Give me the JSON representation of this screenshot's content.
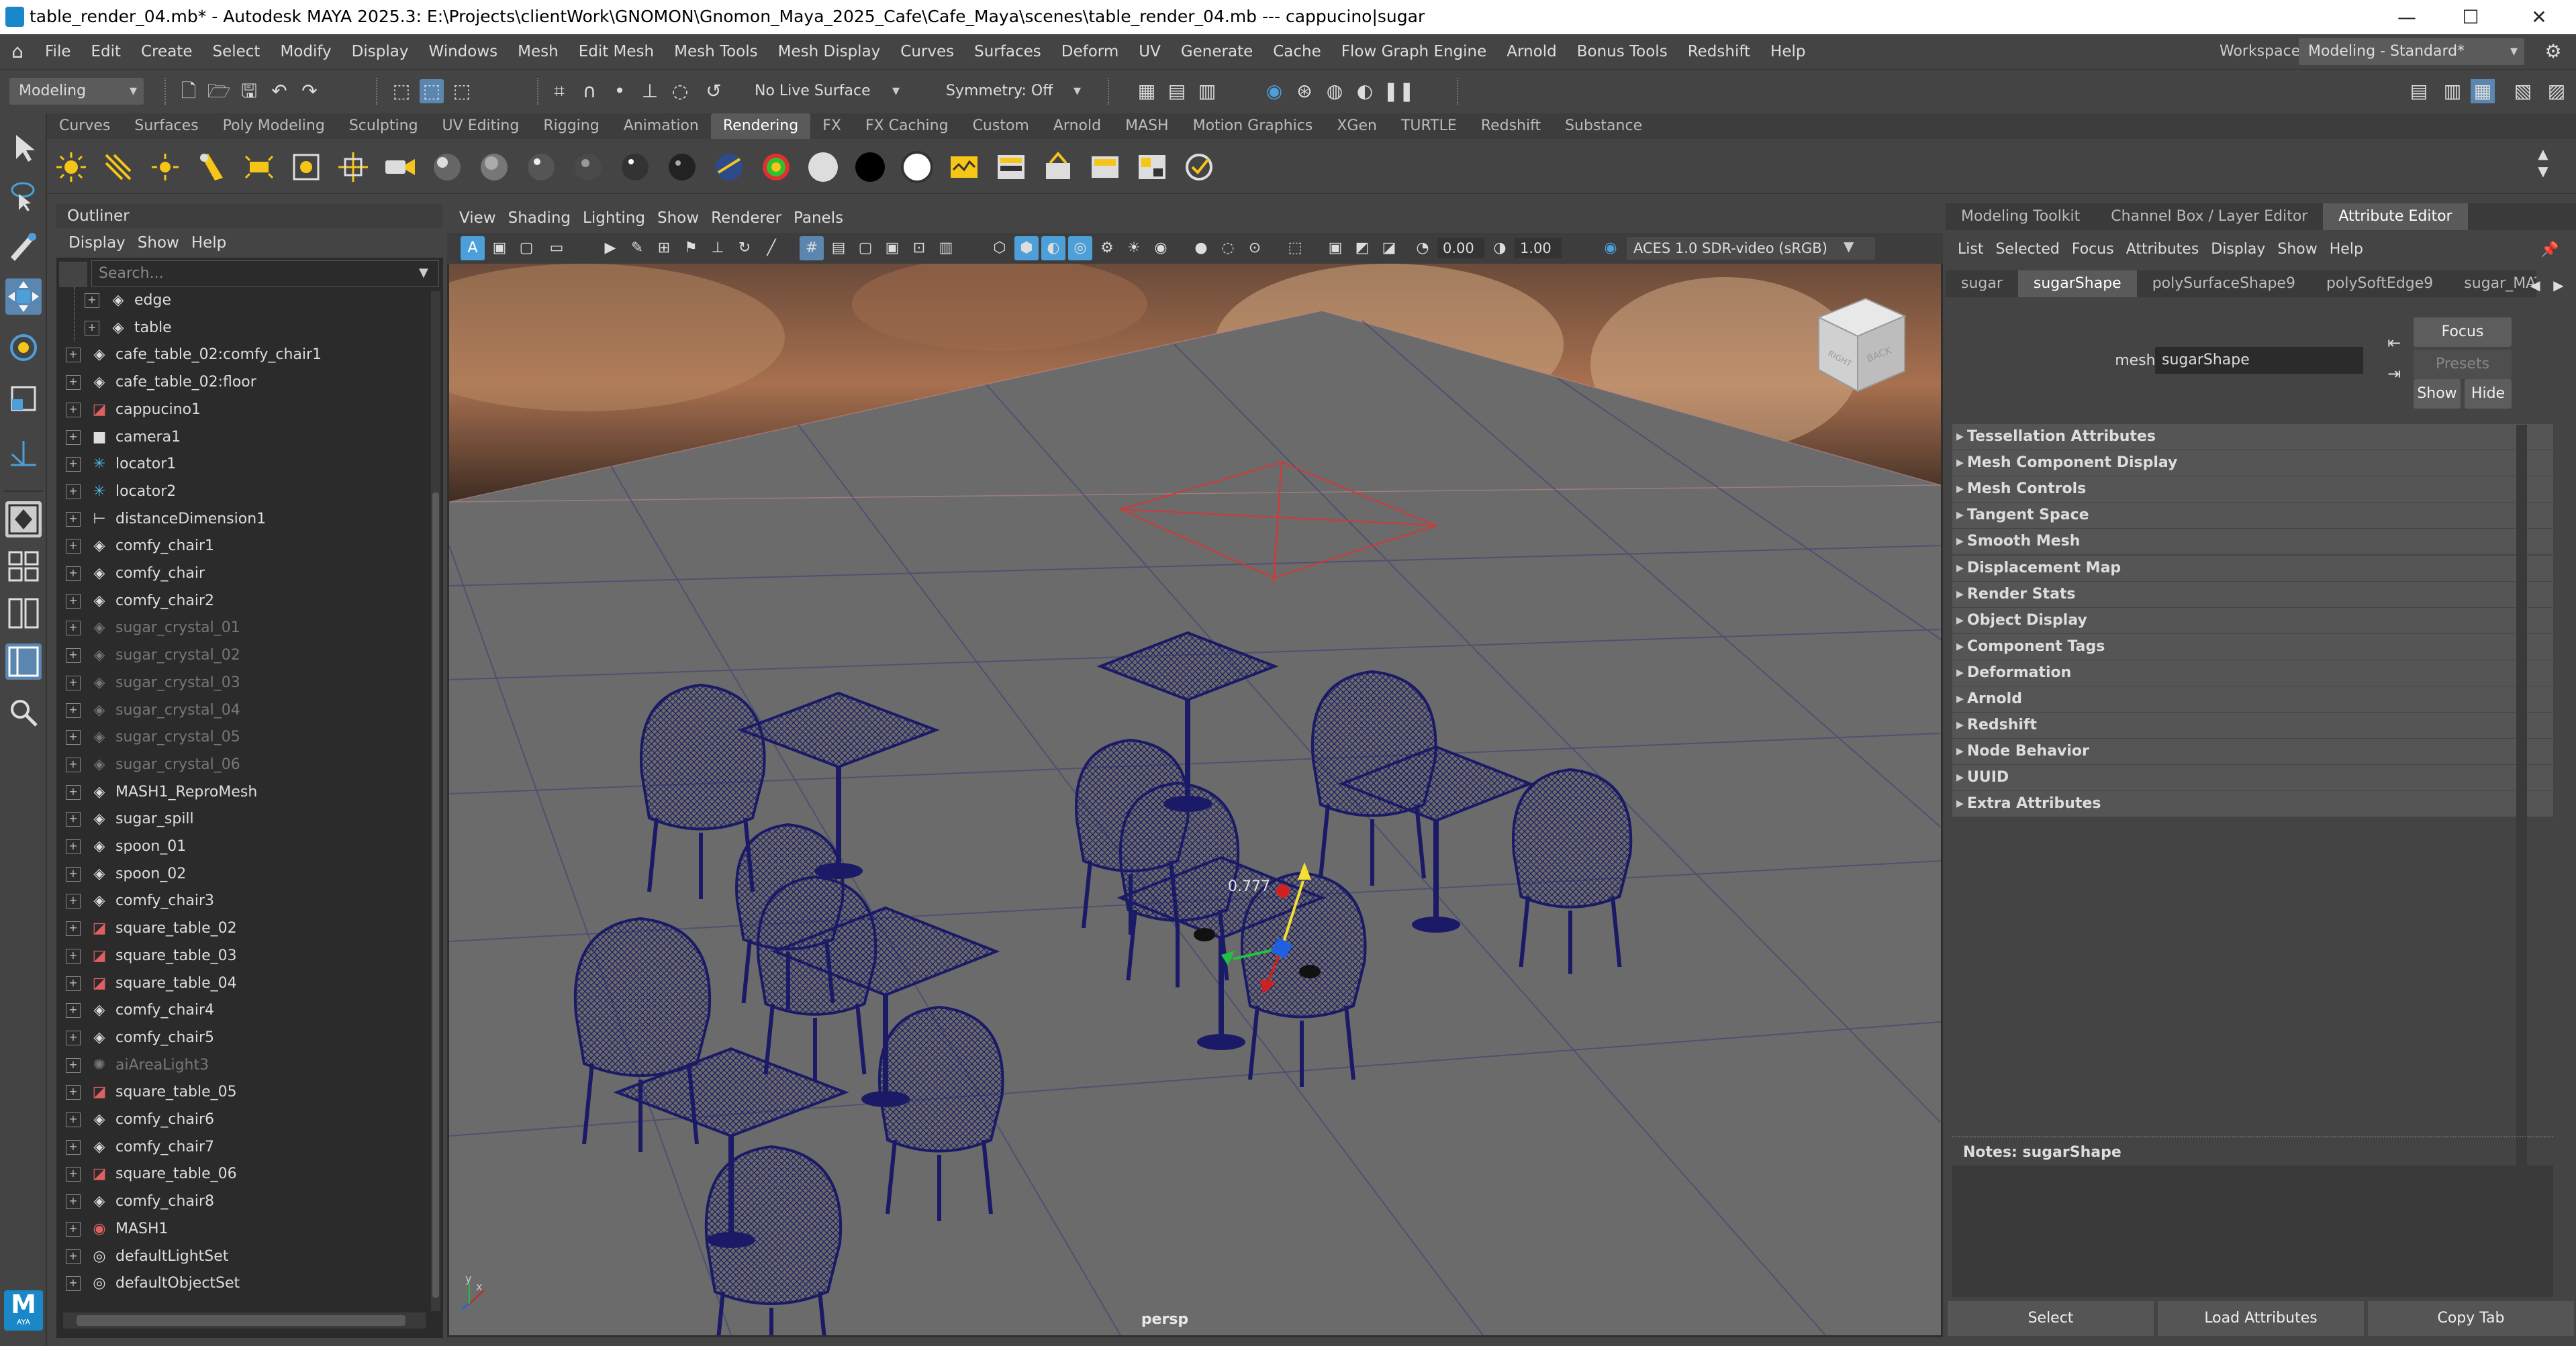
{
  "window": {
    "title": "table_render_04.mb* - Autodesk MAYA 2025.3: E:\\Projects\\clientWork\\GNOMON\\Gnomon_Maya_2025_Cafe\\Cafe_Maya\\scenes\\table_render_04.mb   ---   cappucino|sugar",
    "minimize": "—",
    "maximize": "☐",
    "close": "✕"
  },
  "menubar": {
    "items": [
      "File",
      "Edit",
      "Create",
      "Select",
      "Modify",
      "Display",
      "Windows",
      "Mesh",
      "Edit Mesh",
      "Mesh Tools",
      "Mesh Display",
      "Curves",
      "Surfaces",
      "Deform",
      "UV",
      "Generate",
      "Cache",
      "Flow Graph Engine",
      "Arnold",
      "Bonus Tools",
      "Redshift",
      "Help"
    ],
    "workspace_label": "Workspace:",
    "workspace_value": "Modeling - Standard*"
  },
  "statusline": {
    "menuset": "Modeling",
    "live_surface": "No Live Surface",
    "symmetry": "Symmetry: Off"
  },
  "shelf": {
    "tabs": [
      "Curves",
      "Surfaces",
      "Poly Modeling",
      "Sculpting",
      "UV Editing",
      "Rigging",
      "Animation",
      "Rendering",
      "FX",
      "FX Caching",
      "Custom",
      "Arnold",
      "MASH",
      "Motion Graphics",
      "XGen",
      "TURTLE",
      "Redshift",
      "Substance"
    ],
    "active_tab": "Rendering"
  },
  "outliner": {
    "title": "Outliner",
    "menu": [
      "Display",
      "Show",
      "Help"
    ],
    "search_placeholder": "Search...",
    "items": [
      {
        "label": "edge",
        "icon": "group-icon",
        "dim": false,
        "indent": 1
      },
      {
        "label": "table",
        "icon": "group-icon",
        "dim": false,
        "indent": 1
      },
      {
        "label": "cafe_table_02:comfy_chair1",
        "icon": "group-icon",
        "dim": false,
        "indent": 0
      },
      {
        "label": "cafe_table_02:floor",
        "icon": "group-icon",
        "dim": false,
        "indent": 0
      },
      {
        "label": "cappucino1",
        "icon": "mesh-icon",
        "dim": false,
        "indent": 0
      },
      {
        "label": "camera1",
        "icon": "camera-icon",
        "dim": false,
        "indent": 0
      },
      {
        "label": "locator1",
        "icon": "locator-icon",
        "dim": false,
        "indent": 0
      },
      {
        "label": "locator2",
        "icon": "locator-icon",
        "dim": false,
        "indent": 0
      },
      {
        "label": "distanceDimension1",
        "icon": "distance-icon",
        "dim": false,
        "indent": 0
      },
      {
        "label": "comfy_chair1",
        "icon": "group-icon",
        "dim": false,
        "indent": 0
      },
      {
        "label": "comfy_chair",
        "icon": "group-icon",
        "dim": false,
        "indent": 0
      },
      {
        "label": "comfy_chair2",
        "icon": "group-icon",
        "dim": false,
        "indent": 0
      },
      {
        "label": "sugar_crystal_01",
        "icon": "group-icon",
        "dim": true,
        "indent": 0
      },
      {
        "label": "sugar_crystal_02",
        "icon": "group-icon",
        "dim": true,
        "indent": 0
      },
      {
        "label": "sugar_crystal_03",
        "icon": "group-icon",
        "dim": true,
        "indent": 0
      },
      {
        "label": "sugar_crystal_04",
        "icon": "group-icon",
        "dim": true,
        "indent": 0
      },
      {
        "label": "sugar_crystal_05",
        "icon": "group-icon",
        "dim": true,
        "indent": 0
      },
      {
        "label": "sugar_crystal_06",
        "icon": "group-icon",
        "dim": true,
        "indent": 0
      },
      {
        "label": "MASH1_ReproMesh",
        "icon": "group-icon",
        "dim": false,
        "indent": 0
      },
      {
        "label": "sugar_spill",
        "icon": "group-icon",
        "dim": false,
        "indent": 0
      },
      {
        "label": "spoon_01",
        "icon": "group-icon",
        "dim": false,
        "indent": 0
      },
      {
        "label": "spoon_02",
        "icon": "group-icon",
        "dim": false,
        "indent": 0
      },
      {
        "label": "comfy_chair3",
        "icon": "group-icon",
        "dim": false,
        "indent": 0
      },
      {
        "label": "square_table_02",
        "icon": "mesh-icon",
        "dim": false,
        "indent": 0
      },
      {
        "label": "square_table_03",
        "icon": "mesh-icon",
        "dim": false,
        "indent": 0
      },
      {
        "label": "square_table_04",
        "icon": "mesh-icon",
        "dim": false,
        "indent": 0
      },
      {
        "label": "comfy_chair4",
        "icon": "group-icon",
        "dim": false,
        "indent": 0
      },
      {
        "label": "comfy_chair5",
        "icon": "group-icon",
        "dim": false,
        "indent": 0
      },
      {
        "label": "aiAreaLight3",
        "icon": "light-icon",
        "dim": true,
        "indent": 0
      },
      {
        "label": "square_table_05",
        "icon": "mesh-icon",
        "dim": false,
        "indent": 0
      },
      {
        "label": "comfy_chair6",
        "icon": "group-icon",
        "dim": false,
        "indent": 0
      },
      {
        "label": "comfy_chair7",
        "icon": "group-icon",
        "dim": false,
        "indent": 0
      },
      {
        "label": "square_table_06",
        "icon": "mesh-icon",
        "dim": false,
        "indent": 0
      },
      {
        "label": "comfy_chair8",
        "icon": "group-icon",
        "dim": false,
        "indent": 0
      },
      {
        "label": "MASH1",
        "icon": "mash-icon",
        "dim": false,
        "indent": 0
      },
      {
        "label": "defaultLightSet",
        "icon": "set-icon",
        "dim": false,
        "indent": 0
      },
      {
        "label": "defaultObjectSet",
        "icon": "set-icon",
        "dim": false,
        "indent": 0
      }
    ]
  },
  "viewport": {
    "menu": [
      "View",
      "Shading",
      "Lighting",
      "Show",
      "Renderer",
      "Panels"
    ],
    "exposure": "0.00",
    "gamma": "1.00",
    "color_space": "ACES 1.0 SDR-video (sRGB)",
    "camera_label": "persp",
    "viewcube_front": "RIGHT",
    "viewcube_back": "BACK",
    "axis_x": "x",
    "axis_y": "y",
    "distance_readout": "0.777"
  },
  "attribute_editor": {
    "panel_tabs": [
      "Modeling Toolkit",
      "Channel Box / Layer Editor",
      "Attribute Editor"
    ],
    "active_panel_tab": "Attribute Editor",
    "menu": [
      "List",
      "Selected",
      "Focus",
      "Attributes",
      "Display",
      "Show",
      "Help"
    ],
    "node_tabs": [
      "sugar",
      "sugarShape",
      "polySurfaceShape9",
      "polySoftEdge9",
      "sugar_MAT"
    ],
    "active_node_tab": "sugarShape",
    "mesh_label": "mesh:",
    "mesh_value": "sugarShape",
    "focus_btn": "Focus",
    "presets_btn": "Presets",
    "show_btn": "Show",
    "hide_btn": "Hide",
    "sections": [
      "Tessellation Attributes",
      "Mesh Component Display",
      "Mesh Controls",
      "Tangent Space",
      "Smooth Mesh",
      "Displacement Map",
      "Render Stats",
      "Object Display",
      "Component Tags",
      "Deformation",
      "Arnold",
      "Redshift",
      "Node Behavior",
      "UUID",
      "Extra Attributes"
    ],
    "notes_label": "Notes:",
    "notes_node": "sugarShape",
    "bottom_buttons": [
      "Select",
      "Load Attributes",
      "Copy Tab"
    ]
  },
  "colors": {
    "wireframe": "#1a1a66",
    "grid": "#3a3a78",
    "accent_blue": "#4c9fd8",
    "floor": "#6b6b6b"
  },
  "logo_text": "M",
  "logo_sub": "AYA"
}
